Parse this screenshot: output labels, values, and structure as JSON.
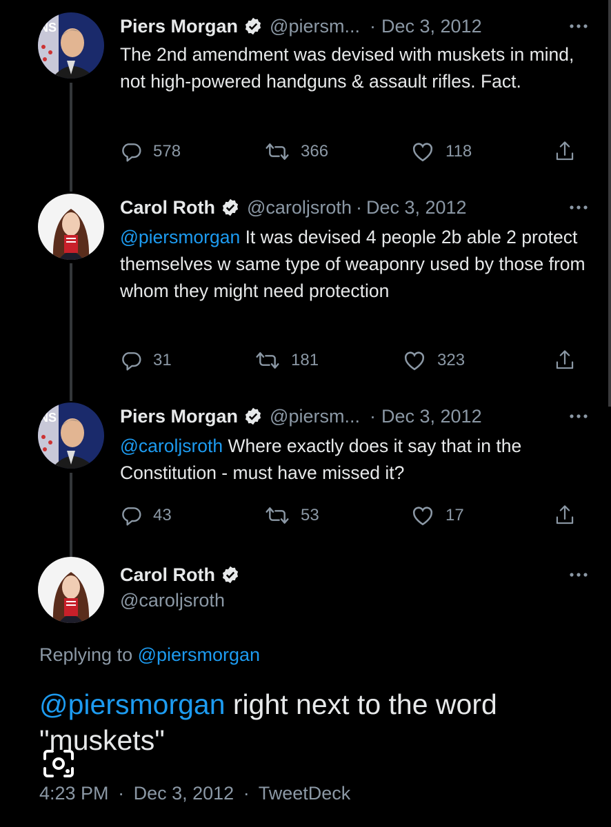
{
  "tweets": [
    {
      "name": "Piers Morgan",
      "handle": "@piersm...",
      "date": "Dec 3, 2012",
      "text": "The 2nd amendment was devised with muskets in mind, not high-powered handguns & assault rifles. Fact.",
      "mention": "",
      "replies": "578",
      "retweets": "366",
      "likes": "118"
    },
    {
      "name": "Carol Roth",
      "handle": "@caroljsroth",
      "date": "Dec 3, 2012",
      "mention": "@piersmorgan",
      "text": " It was devised 4 people 2b able 2 protect themselves w same type of weaponry used by those from whom they might need protection",
      "replies": "31",
      "retweets": "181",
      "likes": "323"
    },
    {
      "name": "Piers Morgan",
      "handle": "@piersm...",
      "date": "Dec 3, 2012",
      "mention": "@caroljsroth",
      "text": " Where exactly does it say that in the Constitution - must have missed it?",
      "replies": "43",
      "retweets": "53",
      "likes": "17"
    }
  ],
  "main_tweet": {
    "name": "Carol Roth",
    "handle": "@caroljsroth",
    "replying_prefix": "Replying to ",
    "replying_to": "@piersmorgan",
    "mention": "@piersmorgan",
    "text": " right next to the word \"muskets\"",
    "time": "4:23 PM",
    "date": "Dec 3, 2012",
    "source": "TweetDeck"
  },
  "separator": "·",
  "colors": {
    "background": "#000000",
    "text": "#e7e9ea",
    "secondary": "#8b98a5",
    "accent": "#1d9bf0"
  },
  "icons": [
    "verified-badge-icon",
    "more-icon",
    "reply-icon",
    "retweet-icon",
    "like-icon",
    "share-icon",
    "lens-search-icon"
  ]
}
